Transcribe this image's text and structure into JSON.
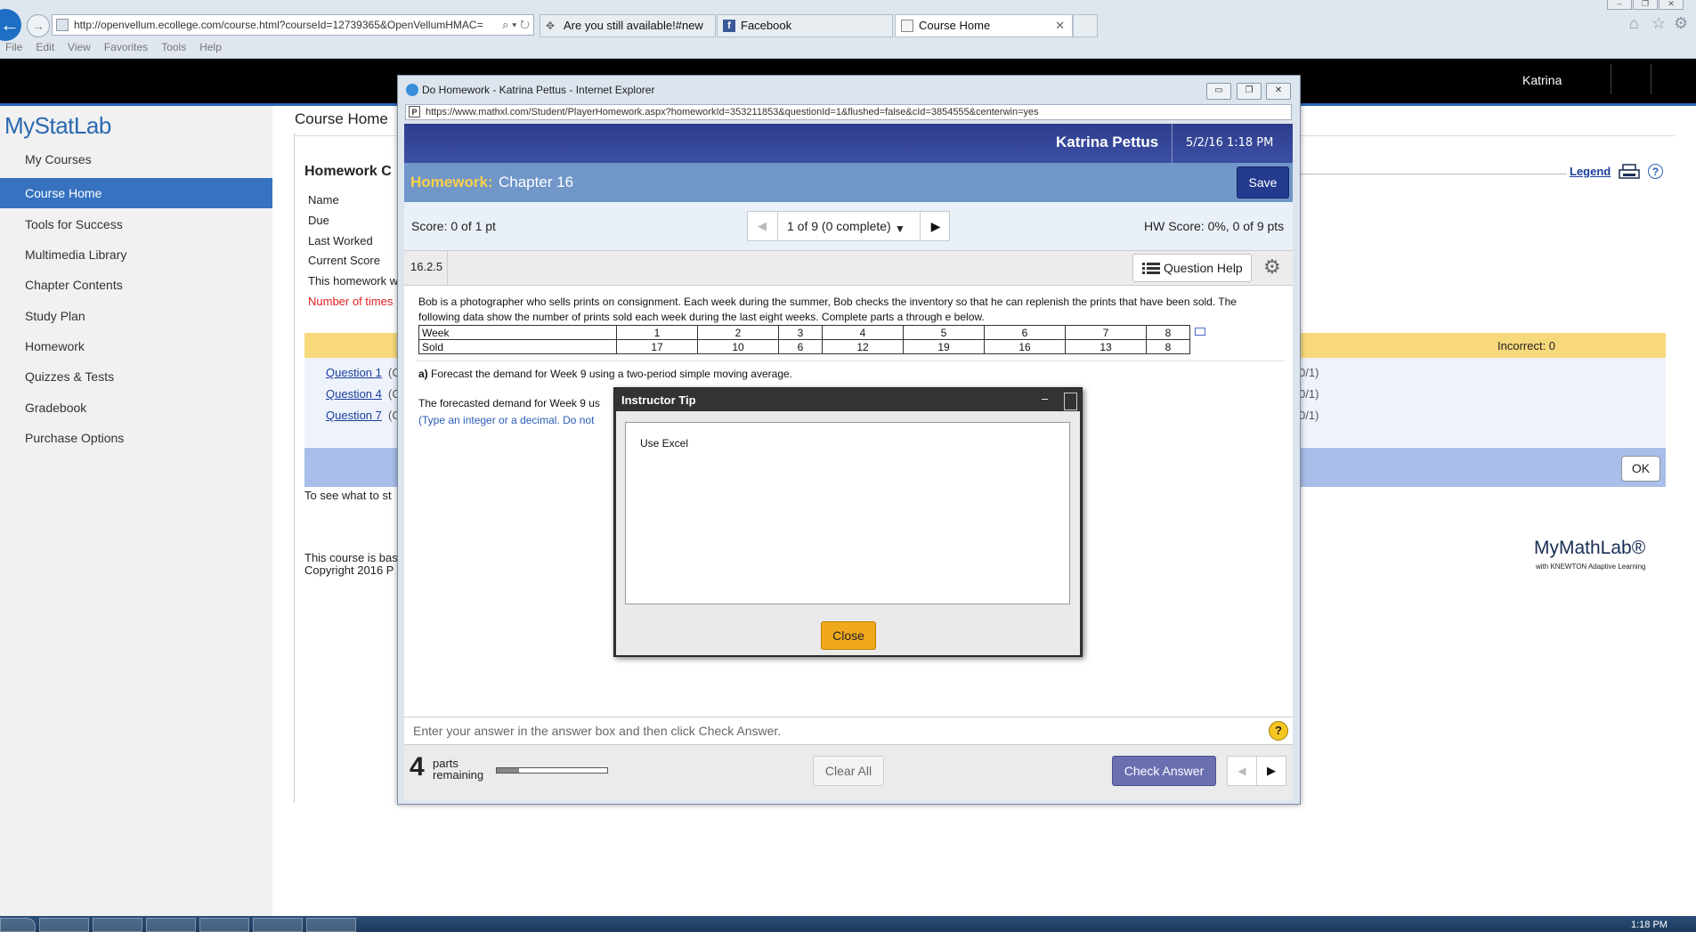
{
  "browser": {
    "address": "http://openvellum.ecollege.com/course.html?courseId=12739365&OpenVellumHMAC=",
    "tabs": [
      {
        "label": "Are you still available!#new",
        "active": false
      },
      {
        "label": "Facebook",
        "active": false
      },
      {
        "label": "Course Home",
        "active": true
      }
    ],
    "menu": [
      "File",
      "Edit",
      "View",
      "Favorites",
      "Tools",
      "Help"
    ]
  },
  "site": {
    "user": "Katrina",
    "logo": "MyStatLab",
    "page_title": "Course Home",
    "sidebar": [
      {
        "label": "My Courses",
        "active": false
      },
      {
        "label": "Course Home",
        "active": true
      },
      {
        "label": "Tools for Success",
        "active": false
      },
      {
        "label": "Multimedia Library",
        "active": false
      },
      {
        "label": "Chapter Contents",
        "active": false
      },
      {
        "label": "Study Plan",
        "active": false
      },
      {
        "label": "Homework",
        "active": false
      },
      {
        "label": "Quizzes & Tests",
        "active": false
      },
      {
        "label": "Gradebook",
        "active": false
      },
      {
        "label": "Purchase Options",
        "active": false
      }
    ],
    "hw_heading": "Homework C",
    "info_labels": [
      "Name",
      "Due",
      "Last Worked",
      "Current Score",
      "This homework w",
      "Number of times"
    ],
    "legend": "Legend",
    "incorrect": "Incorrect: 0",
    "questions": [
      {
        "link": "Question 1",
        "paren": "(C",
        "score": "0/1)"
      },
      {
        "link": "Question 4",
        "paren": "(C",
        "score": "0/1)"
      },
      {
        "link": "Question 7",
        "paren": "(C",
        "score": "0/1)"
      }
    ],
    "ok": "OK",
    "see_text": "To see what to st",
    "course_text": "This course is bas",
    "copyright": "Copyright 2016 P",
    "mml_logo": "MyMathLab®",
    "mml_sub": "with KNEWTON Adaptive Learning"
  },
  "popup": {
    "window_title": "Do Homework - Katrina Pettus - Internet Explorer",
    "url": "https://www.mathxl.com/Student/PlayerHomework.aspx?homeworkId=353211853&questionId=1&flushed=false&cId=3854555&centerwin=yes",
    "student": "Katrina Pettus",
    "date": "5/2/16 1:18 PM",
    "hw_label": "Homework:",
    "chapter": "Chapter 16",
    "save": "Save",
    "score": "Score: 0 of 1 pt",
    "nav": "1 of 9 (0 complete)",
    "hw_score": "HW Score: 0%, 0 of 9 pts",
    "question_num": "16.2.5",
    "question_help": "Question Help",
    "problem": "Bob is a photographer who sells prints on consignment. Each week during the summer, Bob checks the inventory so that he can replenish the prints that have been sold. The following data show the number of prints sold each week during the last eight weeks. Complete parts a through e below.",
    "table": {
      "row1_label": "Week",
      "row1": [
        "1",
        "2",
        "3",
        "4",
        "5",
        "6",
        "7",
        "8"
      ],
      "row2_label": "Sold",
      "row2": [
        "17",
        "10",
        "6",
        "12",
        "19",
        "16",
        "13",
        "8"
      ]
    },
    "part_a_bold": "a)",
    "part_a": "Forecast the demand for Week 9 using a two-period simple moving average.",
    "forecast": "The forecasted demand for Week 9 us",
    "type_hint": "(Type an integer or a decimal. Do not",
    "answer_hint": "Enter your answer in the answer box and then click Check Answer.",
    "parts_num": "4",
    "parts_line1": "parts",
    "parts_line2": "remaining",
    "progress": 0.2,
    "clear_all": "Clear All",
    "check_answer": "Check Answer"
  },
  "tip": {
    "title": "Instructor Tip",
    "text": "Use Excel",
    "close": "Close"
  },
  "taskbar": {
    "clock": "1:18 PM"
  },
  "colors": {
    "accent": "#3672c0",
    "header": "#2d3d8c",
    "hw_label": "#fbd14b"
  }
}
